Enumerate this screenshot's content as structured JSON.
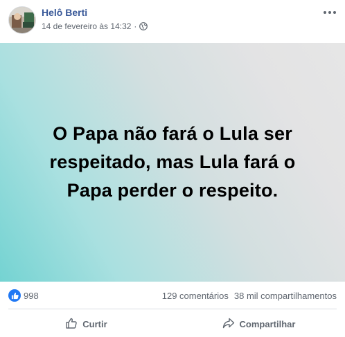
{
  "post": {
    "author": "Helô Berti",
    "timestamp": "14 de fevereiro às 14:32",
    "separator": "·",
    "privacy_icon": "globe-icon",
    "image_text": "O Papa não fará o Lula ser respeitado, mas Lula fará o Papa perder o respeito."
  },
  "stats": {
    "reactions_icon": "like-icon",
    "reactions_count": "998",
    "comments": "129 comentários",
    "shares": "38 mil compartilhamentos"
  },
  "actions": {
    "like_label": "Curtir",
    "share_label": "Compartilhar"
  },
  "colors": {
    "author_link": "#385898",
    "like_blue": "#2078f4",
    "muted_text": "#606770"
  }
}
